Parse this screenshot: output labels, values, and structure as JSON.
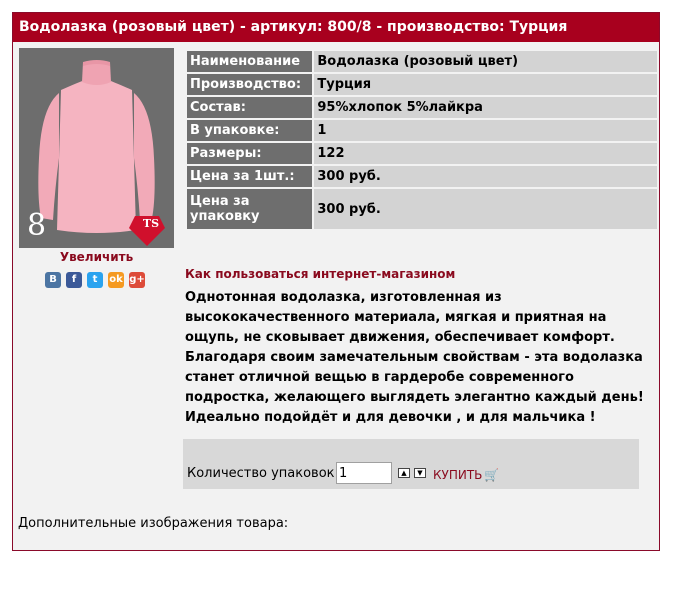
{
  "header": {
    "title": "Водолазка (розовый цвет) - артикул: 800/8 - производство: Турция"
  },
  "photo": {
    "size_digit": "8",
    "logo_text": "TS"
  },
  "enlarge_label": "Увеличить",
  "social": [
    {
      "icon": "vkontakte-icon",
      "glyph": "В",
      "color": "#4c75a3"
    },
    {
      "icon": "facebook-icon",
      "glyph": "f",
      "color": "#3b5998"
    },
    {
      "icon": "twitter-icon",
      "glyph": "t",
      "color": "#2aa3ef"
    },
    {
      "icon": "odnoklassniki-icon",
      "glyph": "ok",
      "color": "#f59a21"
    },
    {
      "icon": "google-plus-icon",
      "glyph": "g+",
      "color": "#dd4b39"
    }
  ],
  "details": [
    {
      "label": "Наименование",
      "value": "Водолазка (розовый цвет)"
    },
    {
      "label": "Производство:",
      "value": "Турция"
    },
    {
      "label": "Состав:",
      "value": "95%хлопок 5%лайкра"
    },
    {
      "label": "В упаковке:",
      "value": "1"
    },
    {
      "label": "Размеры:",
      "value": "122"
    },
    {
      "label": "Цена за 1шт.:",
      "value": "300 руб."
    },
    {
      "label": "Цена за упаковку",
      "value": "300 руб."
    }
  ],
  "howto_link": "Как пользоваться интернет-магазином",
  "description": "Однотонная водолазка, изготовленная из высококачественного материала, мягкая и приятная на ощупь, не сковывает движения, обеспечивает комфорт. Благодаря своим замечательным свойствам - эта водолазка станет отличной вещью в гардеробе современного подростка, желающего выглядеть элегантно каждый день! Идеально подойдёт и для девочки , и для мальчика !",
  "order": {
    "qty_label": "Количество упаковок:",
    "qty_value": "1",
    "buy_label": "КУПИТЬ"
  },
  "extra_images_label": "Дополнительные изображения товара:",
  "colors": {
    "header_bg": "#a8001e",
    "accent_text": "#8a0a1e",
    "key_cell": "#6e6e6e",
    "value_cell": "#d3d3d3"
  }
}
